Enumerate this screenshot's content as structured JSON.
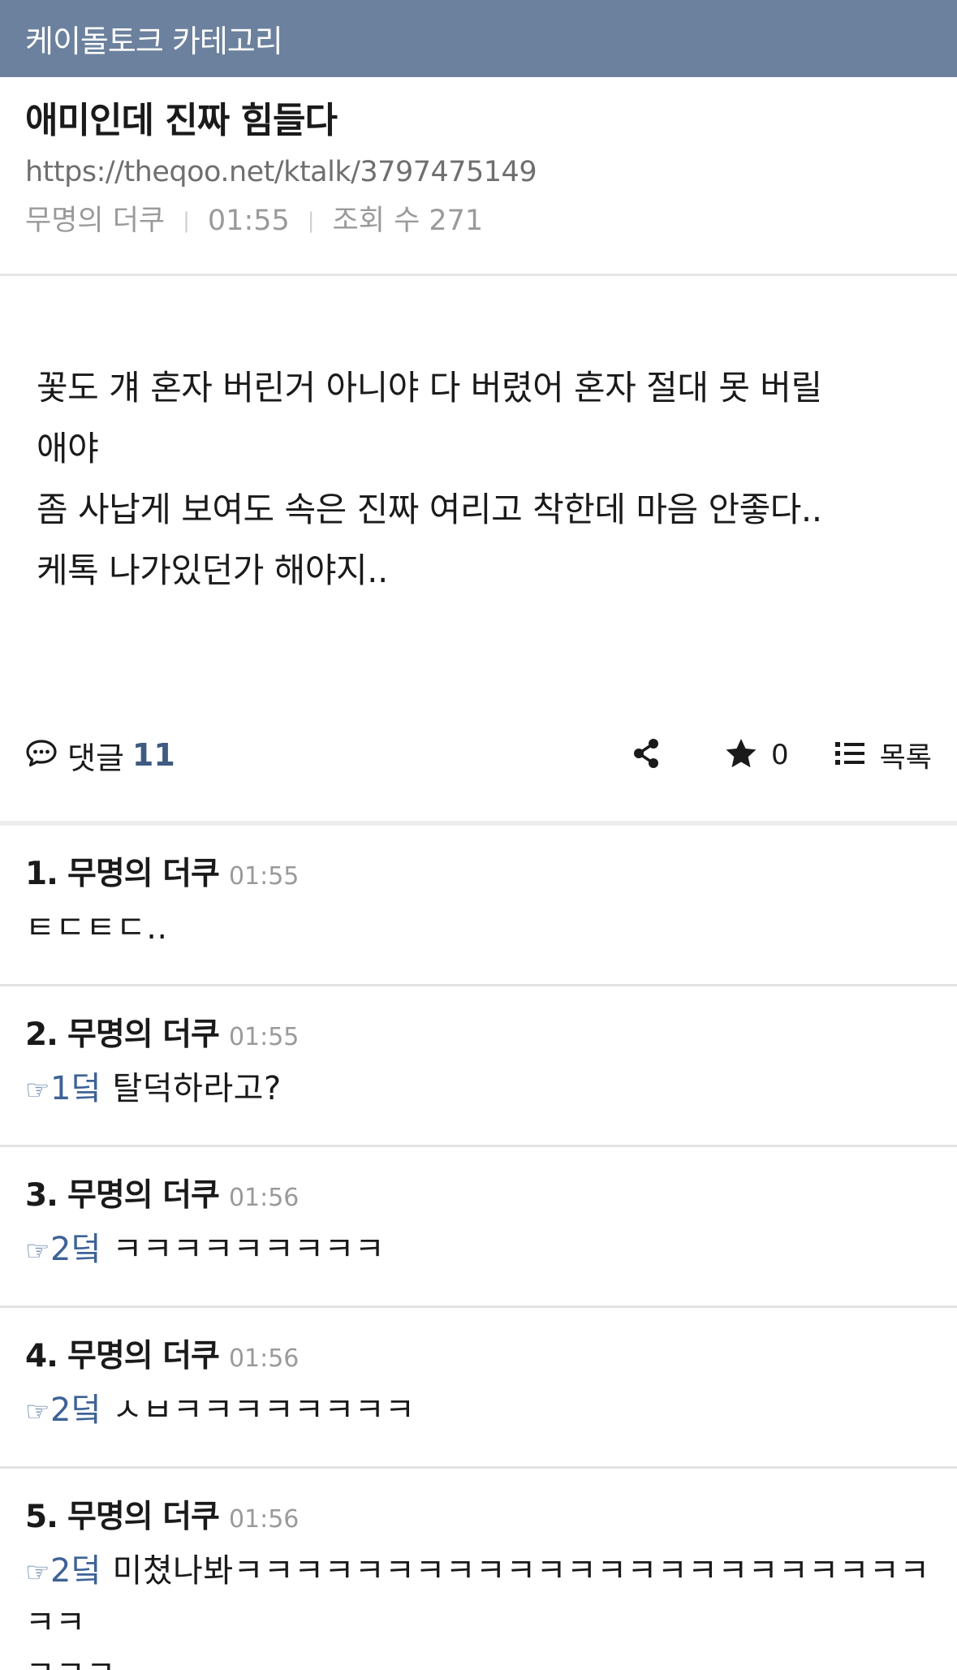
{
  "category_bar": {
    "label": "케이돌토크 카테고리"
  },
  "post": {
    "title": "애미인데 진짜 힘들다",
    "url": "https://theqoo.net/ktalk/3797475149",
    "author": "무명의 더쿠",
    "time": "01:55",
    "views_label": "조회 수 271",
    "body_lines": [
      "꽃도 걔 혼자 버린거 아니야 다 버렸어 혼자 절대 못 버릴",
      "애야",
      "좀 사납게 보여도 속은 진짜 여리고 착한데 마음 안좋다..",
      "케톡 나가있던가 해야지.."
    ]
  },
  "actions": {
    "comment_label": "댓글",
    "comment_count": "11",
    "star_count": "0",
    "list_label": "목록",
    "icons": [
      "comment-bubble-icon",
      "share-icon",
      "star-icon",
      "list-icon"
    ]
  },
  "comments": [
    {
      "num": "1.",
      "author": "무명의 더쿠",
      "time": "01:55",
      "ref_icon": "",
      "ref": "",
      "text": "ㅌㄷㅌㄷ.."
    },
    {
      "num": "2.",
      "author": "무명의 더쿠",
      "time": "01:55",
      "ref_icon": "☞",
      "ref": "1덬",
      "text": " 탈덕하라고?"
    },
    {
      "num": "3.",
      "author": "무명의 더쿠",
      "time": "01:56",
      "ref_icon": "☞",
      "ref": "2덬",
      "text": " ㅋㅋㅋㅋㅋㅋㅋㅋㅋ"
    },
    {
      "num": "4.",
      "author": "무명의 더쿠",
      "time": "01:56",
      "ref_icon": "☞",
      "ref": "2덬",
      "text": " ㅅㅂㅋㅋㅋㅋㅋㅋㅋㅋ"
    },
    {
      "num": "5.",
      "author": "무명의 더쿠",
      "time": "01:56",
      "ref_icon": "☞",
      "ref": "2덬",
      "text": " 미쳤나봐ㅋㅋㅋㅋㅋㅋㅋㅋㅋㅋㅋㅋㅋㅋㅋㅋㅋㅋㅋㅋㅋㅋㅋㅋㅋ",
      "text2": "ㅋㅋㅋ"
    }
  ],
  "colors": {
    "header_bg": "#6b819e",
    "accent_blue": "#3e5b82"
  }
}
